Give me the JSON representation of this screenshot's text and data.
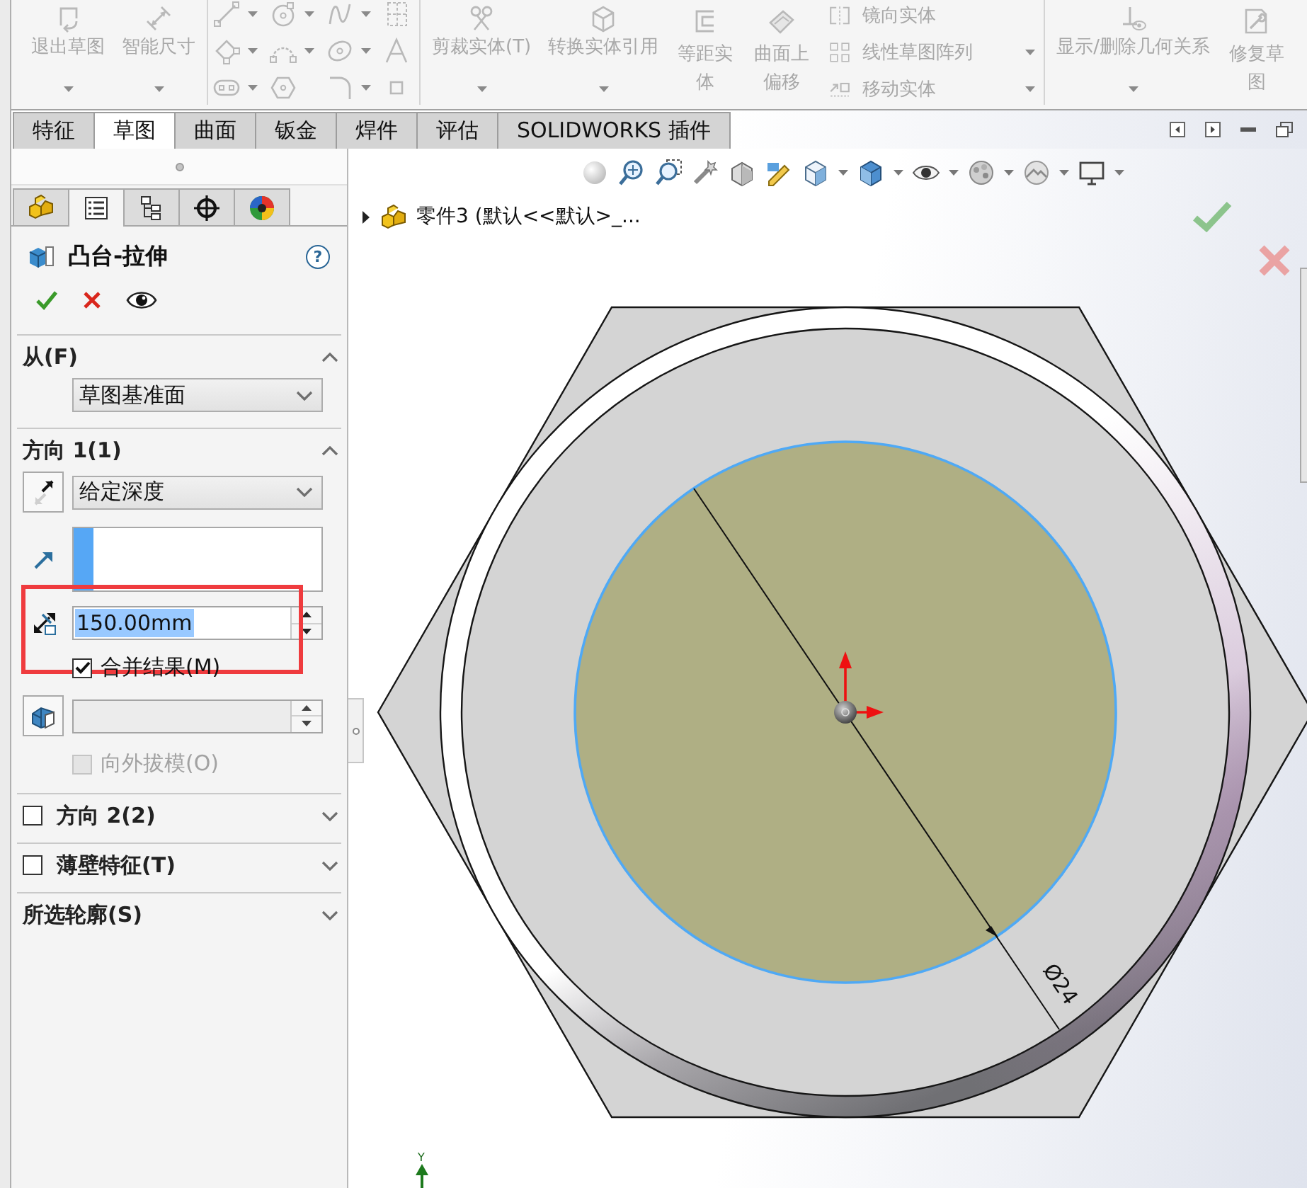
{
  "ribbon": {
    "disabled": true,
    "groups": [
      {
        "items": [
          {
            "kind": "large",
            "label": "退出草图",
            "has_menu": true
          },
          {
            "kind": "large",
            "label": "智能尺寸",
            "has_menu": true
          }
        ]
      },
      {
        "items": [
          {
            "kind": "tool_grid"
          }
        ]
      },
      {
        "items": [
          {
            "kind": "large",
            "label": "剪裁实体(T)",
            "has_menu": true
          },
          {
            "kind": "large",
            "label": "转换实体引用",
            "has_menu": true
          },
          {
            "kind": "large",
            "label": "等距实体",
            "has_menu": false
          },
          {
            "kind": "large",
            "label": "曲面上偏移",
            "has_menu": false
          },
          {
            "kind": "stack",
            "entries": [
              {
                "label": "镜向实体",
                "has_menu": false
              },
              {
                "label": "线性草图阵列",
                "has_menu": true
              },
              {
                "label": "移动实体",
                "has_menu": true
              }
            ]
          }
        ]
      },
      {
        "items": [
          {
            "kind": "large",
            "label": "显示/删除几何关系",
            "has_menu": true
          },
          {
            "kind": "large",
            "label": "修复草图",
            "has_menu": false
          }
        ]
      }
    ]
  },
  "command_tabs": [
    {
      "label": "特征",
      "selected": false
    },
    {
      "label": "草图",
      "selected": true
    },
    {
      "label": "曲面",
      "selected": false
    },
    {
      "label": "钣金",
      "selected": false
    },
    {
      "label": "焊件",
      "selected": false
    },
    {
      "label": "评估",
      "selected": false
    },
    {
      "label": "SOLIDWORKS 插件",
      "selected": false
    }
  ],
  "property_manager": {
    "tabs": [
      {
        "kind": "feature_tree",
        "selected": false
      },
      {
        "kind": "property",
        "selected": true
      },
      {
        "kind": "configuration",
        "selected": false
      },
      {
        "kind": "dimxpert",
        "selected": false
      },
      {
        "kind": "display",
        "selected": false
      }
    ],
    "title": "凸台-拉伸",
    "help": "?",
    "sections": [
      {
        "title": "从(F)",
        "expanded": true,
        "rows": [
          {
            "kind": "select",
            "value": "草图基准面"
          }
        ]
      },
      {
        "title": "方向 1(1)",
        "expanded": true,
        "rows": [
          {
            "kind": "select",
            "value": "给定深度"
          },
          {
            "kind": "selection_box"
          },
          {
            "kind": "spinner",
            "value": "150.00mm",
            "text_selected": true,
            "annotated": true,
            "disabled": false
          },
          {
            "kind": "checkbox",
            "label": "合并结果(M)",
            "checked": true,
            "disabled": false
          },
          {
            "kind": "spinner",
            "disabled": true
          },
          {
            "kind": "checkbox",
            "label": "向外拔模(O)",
            "checked": false,
            "disabled": true
          }
        ]
      },
      {
        "title": "方向 2(2)",
        "expanded": false,
        "checked": false
      },
      {
        "title": "薄壁特征(T)",
        "expanded": false,
        "checked": false
      },
      {
        "title": "所选轮廓(S)",
        "expanded": false
      }
    ]
  },
  "graphics_area": {
    "tree_item": {
      "label": "零件3 (默认<<默认>_...",
      "expanded": false
    },
    "dimension": "Ø24",
    "triad_label": "Y"
  }
}
